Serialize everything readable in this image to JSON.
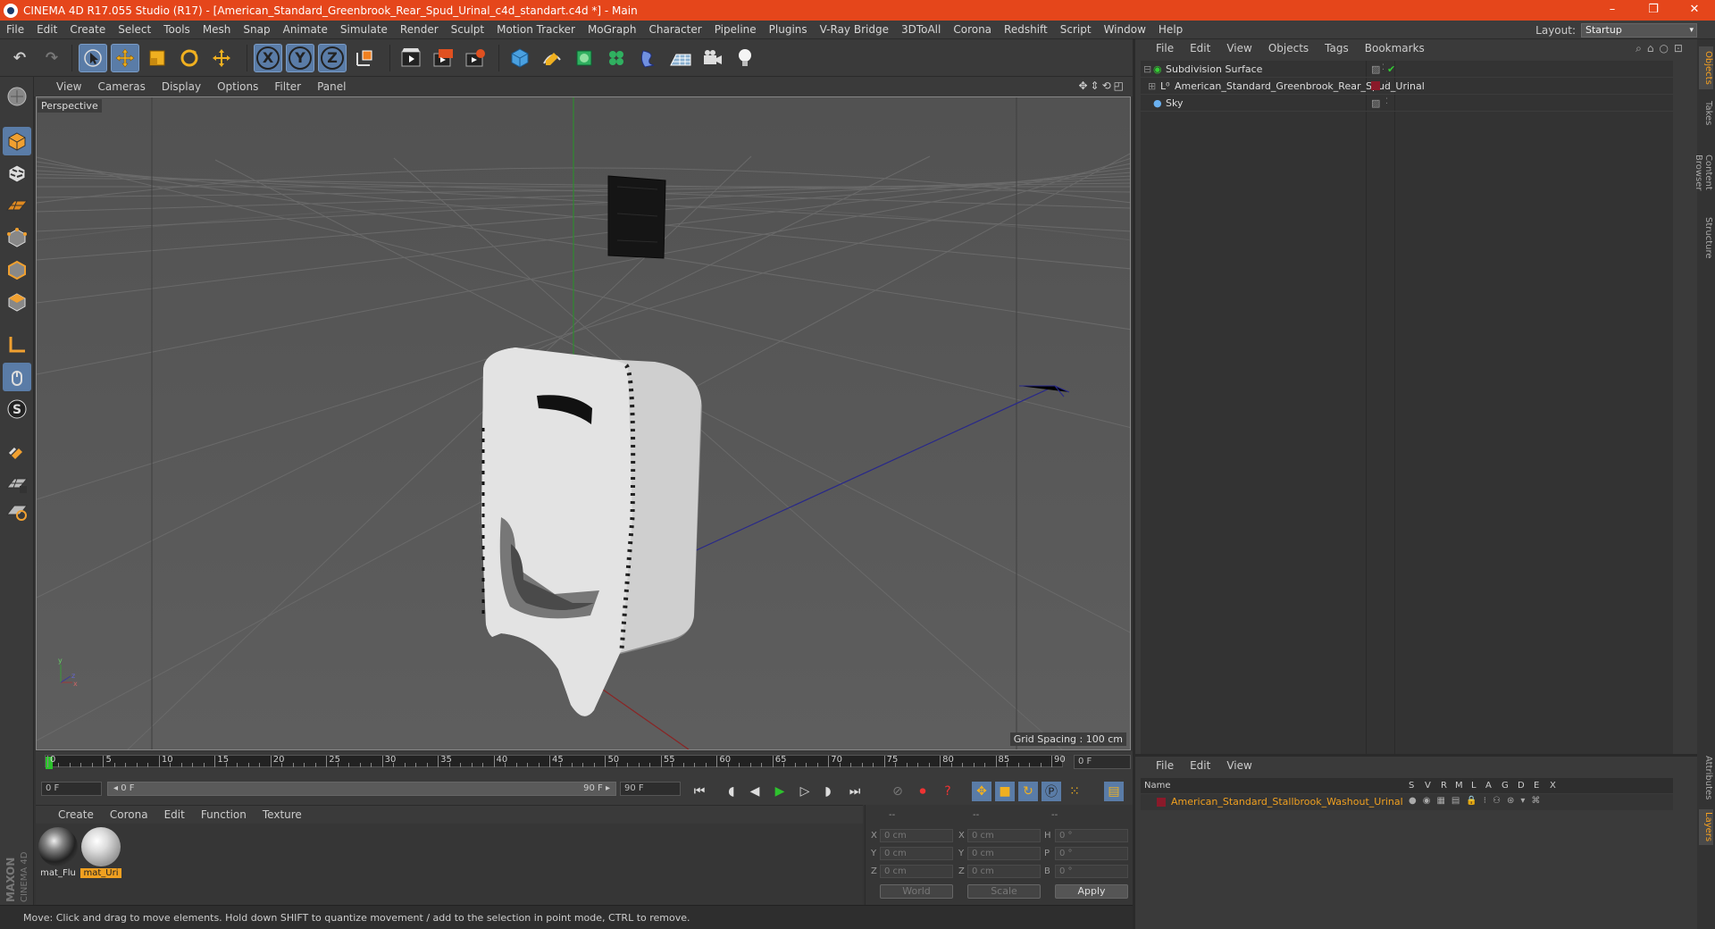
{
  "window": {
    "title": "CINEMA 4D R17.055 Studio (R17) - [American_Standard_Greenbrook_Rear_Spud_Urinal_c4d_standart.c4d *] - Main",
    "controls": [
      "–",
      "❐",
      "✕"
    ]
  },
  "menubar": {
    "items": [
      "File",
      "Edit",
      "Create",
      "Select",
      "Tools",
      "Mesh",
      "Snap",
      "Animate",
      "Simulate",
      "Render",
      "Sculpt",
      "Motion Tracker",
      "MoGraph",
      "Character",
      "Pipeline",
      "Plugins",
      "V-Ray Bridge",
      "3DToAll",
      "Corona",
      "Redshift",
      "Script",
      "Window",
      "Help"
    ],
    "layout_label": "Layout:",
    "layout_value": "Startup"
  },
  "toolbar": {
    "axis_x": "X",
    "axis_y": "Y",
    "axis_z": "Z"
  },
  "viewport": {
    "menu": [
      "View",
      "Cameras",
      "Display",
      "Options",
      "Filter",
      "Panel"
    ],
    "label": "Perspective",
    "grid_spacing": "Grid Spacing : 100 cm"
  },
  "timeline": {
    "ticks": [
      "0",
      "5",
      "10",
      "15",
      "20",
      "25",
      "30",
      "35",
      "40",
      "45",
      "50",
      "55",
      "60",
      "65",
      "70",
      "75",
      "80",
      "85",
      "90"
    ],
    "frame_end_field": "0 F",
    "start_field": "0 F",
    "range_start": "◂ 0 F",
    "range_end": "90 F ▸",
    "end_field": "90 F"
  },
  "materials": {
    "menu": [
      "Create",
      "Corona",
      "Edit",
      "Function",
      "Texture"
    ],
    "items": [
      {
        "name": "mat_Flu",
        "selected": false
      },
      {
        "name": "mat_Uri",
        "selected": true
      }
    ]
  },
  "coordinates": {
    "headers": [
      "--",
      "--",
      "--"
    ],
    "rows": [
      {
        "a": "X",
        "av": "0 cm",
        "b": "X",
        "bv": "0 cm",
        "c": "H",
        "cv": "0 °"
      },
      {
        "a": "Y",
        "av": "0 cm",
        "b": "Y",
        "bv": "0 cm",
        "c": "P",
        "cv": "0 °"
      },
      {
        "a": "Z",
        "av": "0 cm",
        "b": "Z",
        "bv": "0 cm",
        "c": "B",
        "cv": "0 °"
      }
    ],
    "mode1": "World",
    "mode2": "Scale",
    "apply": "Apply"
  },
  "status": "Move: Click and drag to move elements. Hold down SHIFT to quantize movement / add to the selection in point mode, CTRL to remove.",
  "objects": {
    "menu": [
      "File",
      "Edit",
      "View",
      "Objects",
      "Tags",
      "Bookmarks"
    ],
    "rows": [
      {
        "name": "Subdivision Surface"
      },
      {
        "name": "American_Standard_Greenbrook_Rear_Spud_Urinal"
      },
      {
        "name": "Sky"
      }
    ]
  },
  "sidetabs": [
    "Objects",
    "Takes",
    "Content Browser",
    "Structure",
    "Attributes",
    "Layers"
  ],
  "layers": {
    "menu": [
      "File",
      "Edit",
      "View"
    ],
    "headers": [
      "Name",
      "S",
      "V",
      "R",
      "M",
      "L",
      "A",
      "G",
      "D",
      "E",
      "X"
    ],
    "row_name": "American_Standard_Stallbrook_Washout_Urinal"
  },
  "brand": "MAXON CINEMA 4D"
}
